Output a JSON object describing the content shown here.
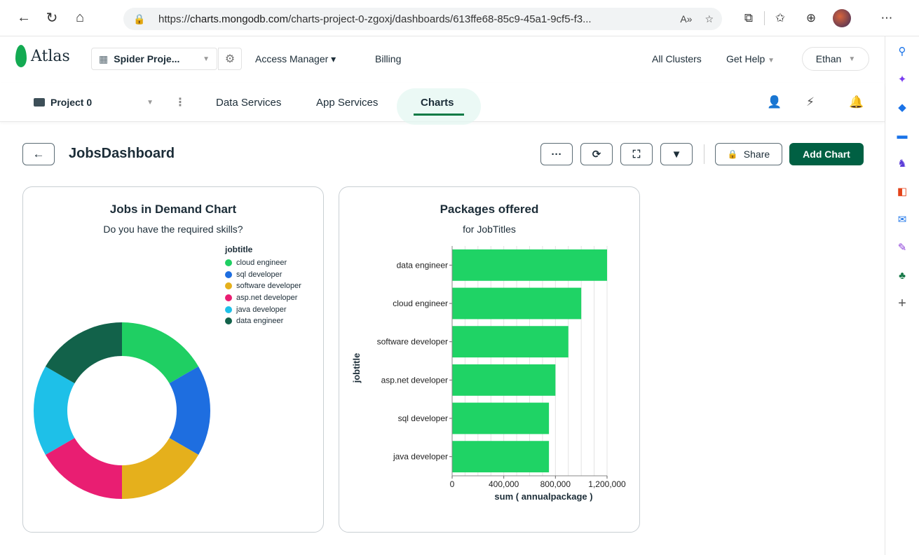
{
  "browser": {
    "url_prefix": "https://",
    "url_host": "charts.mongodb.com",
    "url_rest": "/charts-project-0-zgoxj/dashboards/613ffe68-85c9-45a1-9cf5-f3..."
  },
  "atlas": {
    "logo_text": "Atlas",
    "org_name": "Spider Proje...",
    "access_manager": "Access Manager",
    "billing": "Billing",
    "all_clusters": "All Clusters",
    "get_help": "Get Help",
    "user": "Ethan"
  },
  "subnav": {
    "project": "Project 0",
    "tabs": [
      "Data Services",
      "App Services",
      "Charts"
    ],
    "active_tab": "Charts"
  },
  "dashboard": {
    "title": "JobsDashboard",
    "share_label": "Share",
    "add_chart_label": "Add Chart"
  },
  "colors": {
    "accent_green": "#006043",
    "bar_green": "#1fd365"
  },
  "chart_data": [
    {
      "type": "pie",
      "title": "Jobs in Demand Chart",
      "subtitle": "Do you have the required skills?",
      "legend_title": "jobtitle",
      "categories": [
        "cloud engineer",
        "sql developer",
        "software developer",
        "asp.net developer",
        "java developer",
        "data engineer"
      ],
      "values": [
        1,
        1,
        1,
        1,
        1,
        1
      ],
      "colors": [
        "#1fcf63",
        "#1e6ee0",
        "#e5b01c",
        "#e91e72",
        "#1ec0e8",
        "#12624a"
      ],
      "donut": true
    },
    {
      "type": "bar",
      "orientation": "horizontal",
      "title": "Packages offered",
      "subtitle": "for JobTitles",
      "ylabel": "jobtitle",
      "xlabel": "sum ( annualpackage )",
      "categories": [
        "data engineer",
        "cloud engineer",
        "software developer",
        "asp.net developer",
        "sql developer",
        "java developer"
      ],
      "values": [
        1200000,
        1000000,
        900000,
        800000,
        750000,
        750000
      ],
      "xlim": [
        0,
        1200000
      ],
      "xticks": [
        "0",
        "400,000",
        "800,000",
        "1,200,000"
      ],
      "color": "#1fd365",
      "grid": true
    }
  ]
}
